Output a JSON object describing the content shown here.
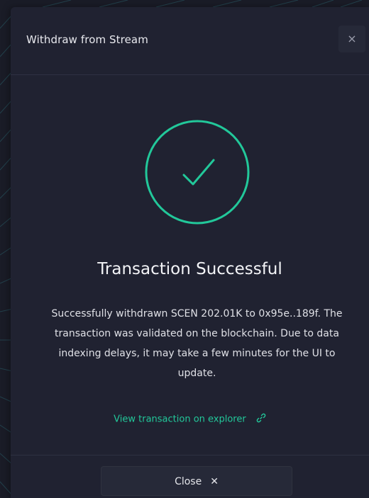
{
  "modal": {
    "title": "Withdraw from Stream",
    "close_icon_glyph": "×"
  },
  "status": {
    "icon": "check-circle-icon",
    "headline": "Transaction Successful",
    "message": "Successfully withdrawn SCEN 202.01K to 0x95e..189f. The transaction was validated on the blockchain. Due to data indexing delays, it may take a few minutes for the UI to update."
  },
  "explorer": {
    "label": "View transaction on explorer",
    "icon": "link-icon"
  },
  "footer": {
    "close_label": "Close",
    "close_glyph": "✕"
  },
  "colors": {
    "accent": "#22c89a",
    "modal_bg": "#202231",
    "text": "#e8e9ee"
  }
}
